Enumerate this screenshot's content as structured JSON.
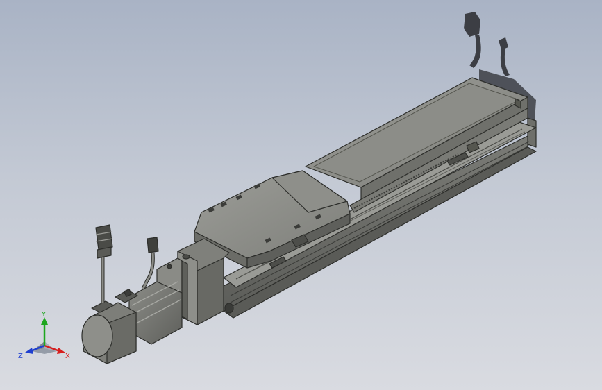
{
  "viewport": {
    "background_top": "#a9b3c5",
    "background_bottom": "#d9dbe1"
  },
  "model": {
    "body_color": "#8a8b86",
    "dark_edge_color": "#2d2e2b",
    "highlight_color": "#b7b8b2",
    "shadow_color": "#3c3e44"
  },
  "triad": {
    "x_label": "X",
    "y_label": "Y",
    "z_label": "Z",
    "x_color": "#d71e1e",
    "y_color": "#1ea61e",
    "z_color": "#1f3fd0"
  }
}
